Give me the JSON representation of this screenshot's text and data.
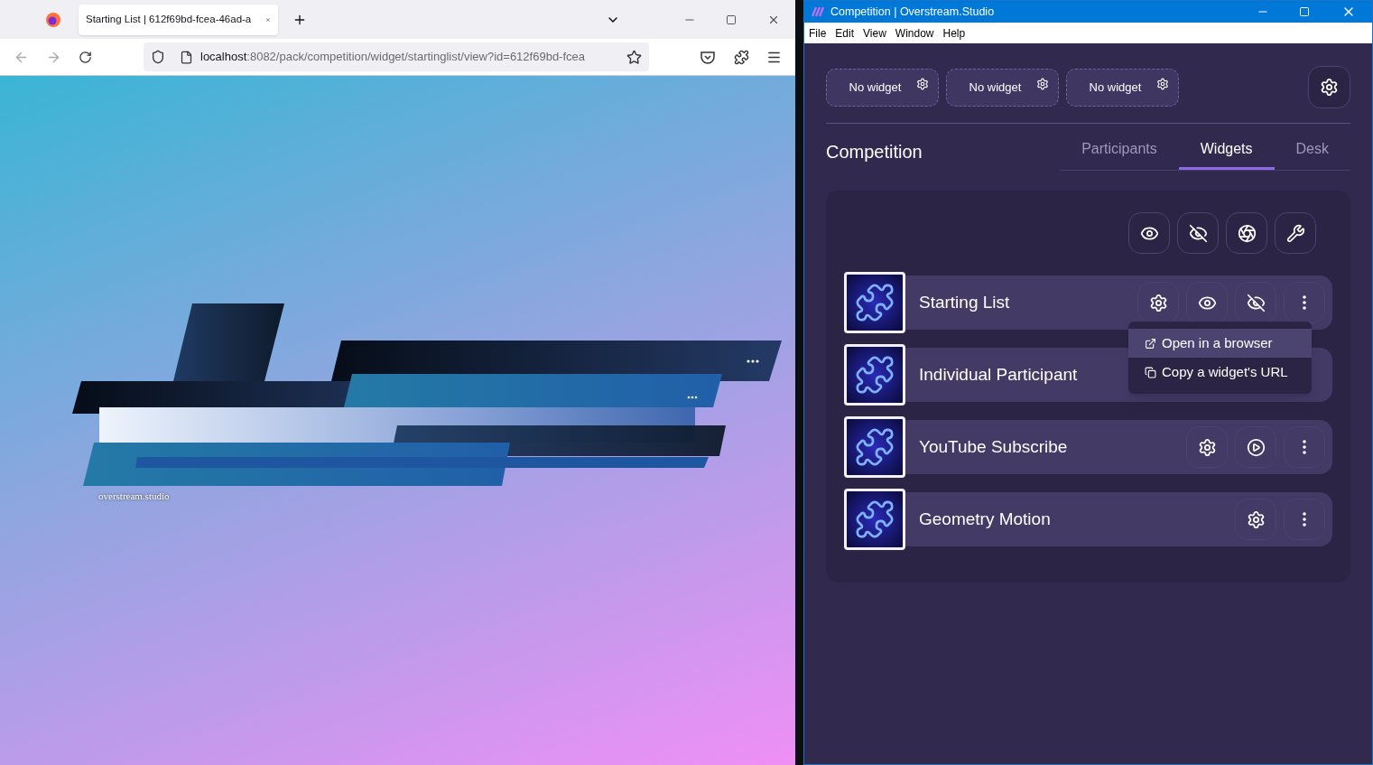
{
  "browser": {
    "tab": {
      "title": "Starting List | 612f69bd-fcea-46ad-a",
      "selected": true
    },
    "address": {
      "host": "localhost",
      "path": ":8082/pack/competition/widget/startinglist/view?id=612f69bd-fcea"
    },
    "page": {
      "watermark_text": "overstream.studio"
    }
  },
  "app": {
    "window": {
      "title": "Competition | Overstream.Studio"
    },
    "menu": [
      "File",
      "Edit",
      "View",
      "Window",
      "Help"
    ],
    "slots": [
      {
        "label": "No widget"
      },
      {
        "label": "No widget"
      },
      {
        "label": "No widget"
      }
    ],
    "heading": "Competition",
    "tabs": [
      {
        "label": "Participants",
        "selected": false
      },
      {
        "label": "Widgets",
        "selected": true
      },
      {
        "label": "Desk",
        "selected": false
      }
    ],
    "toolbar": [
      {
        "kind": "show"
      },
      {
        "kind": "hide"
      },
      {
        "kind": "obs"
      },
      {
        "kind": "wrench"
      }
    ],
    "widgets": [
      {
        "name": "Starting List",
        "actions": [
          {
            "kind": "settings"
          },
          {
            "kind": "show"
          },
          {
            "kind": "hide"
          },
          {
            "kind": "more"
          }
        ],
        "menu": [
          {
            "label": "Open in a browser",
            "kind": "external",
            "selected": true
          },
          {
            "label": "Copy a widget's URL",
            "kind": "copy",
            "selected": false
          }
        ]
      },
      {
        "name": "Individual Participant"
      },
      {
        "name": "YouTube Subscribe",
        "actions": [
          {
            "kind": "settings"
          },
          {
            "kind": "play"
          },
          {
            "kind": "more"
          }
        ]
      },
      {
        "name": "Geometry Motion",
        "actions": [
          {
            "kind": "settings"
          },
          {
            "kind": "more"
          }
        ]
      }
    ]
  }
}
